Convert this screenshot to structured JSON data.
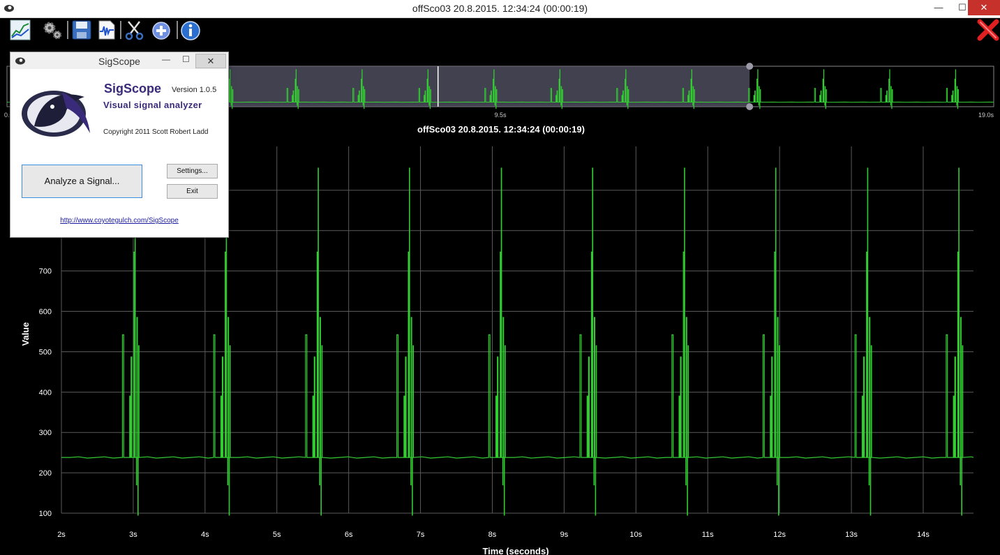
{
  "window": {
    "title": "offSco03 20.8.2015. 12:34:24 (00:00:19)",
    "minimize": "—",
    "maximize": "☐",
    "close": "✕"
  },
  "toolbar": {
    "items": [
      "chart-icon",
      "settings-icon",
      "save-icon",
      "waveform-icon",
      "cut-icon",
      "add-icon",
      "info-icon"
    ],
    "close_icon": "red-x-icon"
  },
  "overview": {
    "tick_left": "0.0s",
    "tick_mid": "9.5s",
    "tick_right": "19.0s",
    "selection_start": 2.0,
    "selection_end": 14.3,
    "cursor": 8.3,
    "total": 19.0
  },
  "chart_data": {
    "type": "line",
    "title": "offSco03 20.8.2015. 12:34:24 (00:00:19)",
    "xlabel": "Time (seconds)",
    "ylabel": "Value",
    "xlim": [
      2.0,
      14.7
    ],
    "ylim": [
      100,
      1000
    ],
    "x_ticks": [
      "2s",
      "3s",
      "4s",
      "5s",
      "6s",
      "7s",
      "8s",
      "9s",
      "10s",
      "11s",
      "12s",
      "13s",
      "14s"
    ],
    "y_ticks": [
      "100",
      "200",
      "300",
      "400",
      "500",
      "600",
      "700"
    ],
    "grid": true,
    "color": "#33cc33",
    "baseline": 238,
    "burst_period_s": 1.27,
    "burst_starts_s": [
      2.85,
      4.12,
      5.4,
      6.67,
      7.95,
      9.22,
      10.5,
      11.77,
      13.05,
      14.32
    ],
    "burst_pulses": [
      {
        "dt": 0.0,
        "w": 0.018,
        "v": 542
      },
      {
        "dt": 0.12,
        "w": 0.01,
        "v": 487
      },
      {
        "dt": 0.16,
        "w": 0.012,
        "v": 747
      },
      {
        "dt": 0.2,
        "w": 0.008,
        "v": 585
      },
      {
        "dt": 0.225,
        "w": 0.006,
        "v": 515
      },
      {
        "dt": 0.1,
        "w": 0.01,
        "v": 390
      }
    ],
    "spikes": [
      {
        "dt": 0.175,
        "v": 955
      },
      {
        "dt": 0.215,
        "v": 95
      },
      {
        "dt": 0.195,
        "v": 170
      }
    ]
  },
  "dialog": {
    "title": "SigScope",
    "product": "SigScope",
    "version": "Version 1.0.5",
    "subtitle": "Visual signal analyzer",
    "copyright": "Copyright 2011 Scott Robert Ladd",
    "analyze_button": "Analyze a Signal...",
    "settings_button": "Settings...",
    "exit_button": "Exit",
    "link": "http://www.coyotegulch.com/SigScope",
    "minimize": "—",
    "maximize": "☐",
    "close": "✕"
  }
}
